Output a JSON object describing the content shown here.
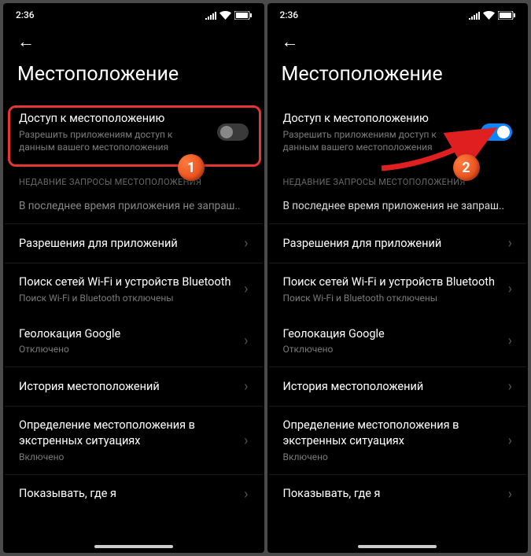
{
  "status": {
    "time": "2:36"
  },
  "header": {
    "title": "Местоположение"
  },
  "access": {
    "title": "Доступ к местоположению",
    "sub": "Разрешить приложениям доступ к данным вашего местоположения"
  },
  "section_recent": "НЕДАВНИЕ ЗАПРОСЫ МЕСТОПОЛОЖЕНИЯ",
  "recent_text": "В последнее время приложения не запраш..",
  "items": {
    "perms": {
      "title": "Разрешения для приложений"
    },
    "wifi": {
      "title": "Поиск сетей Wi-Fi и устройств Bluetooth",
      "sub": "Поиск Wi-Fi и Bluetooth отключены"
    },
    "google": {
      "title": "Геолокация Google",
      "sub": "Отключено"
    },
    "history": {
      "title": "История местоположений"
    },
    "emergency": {
      "title": "Определение местоположения в экстренных ситуациях",
      "sub": "Включено"
    },
    "show": {
      "title": "Показывать, где я"
    }
  },
  "badges": {
    "one": "1",
    "two": "2"
  }
}
